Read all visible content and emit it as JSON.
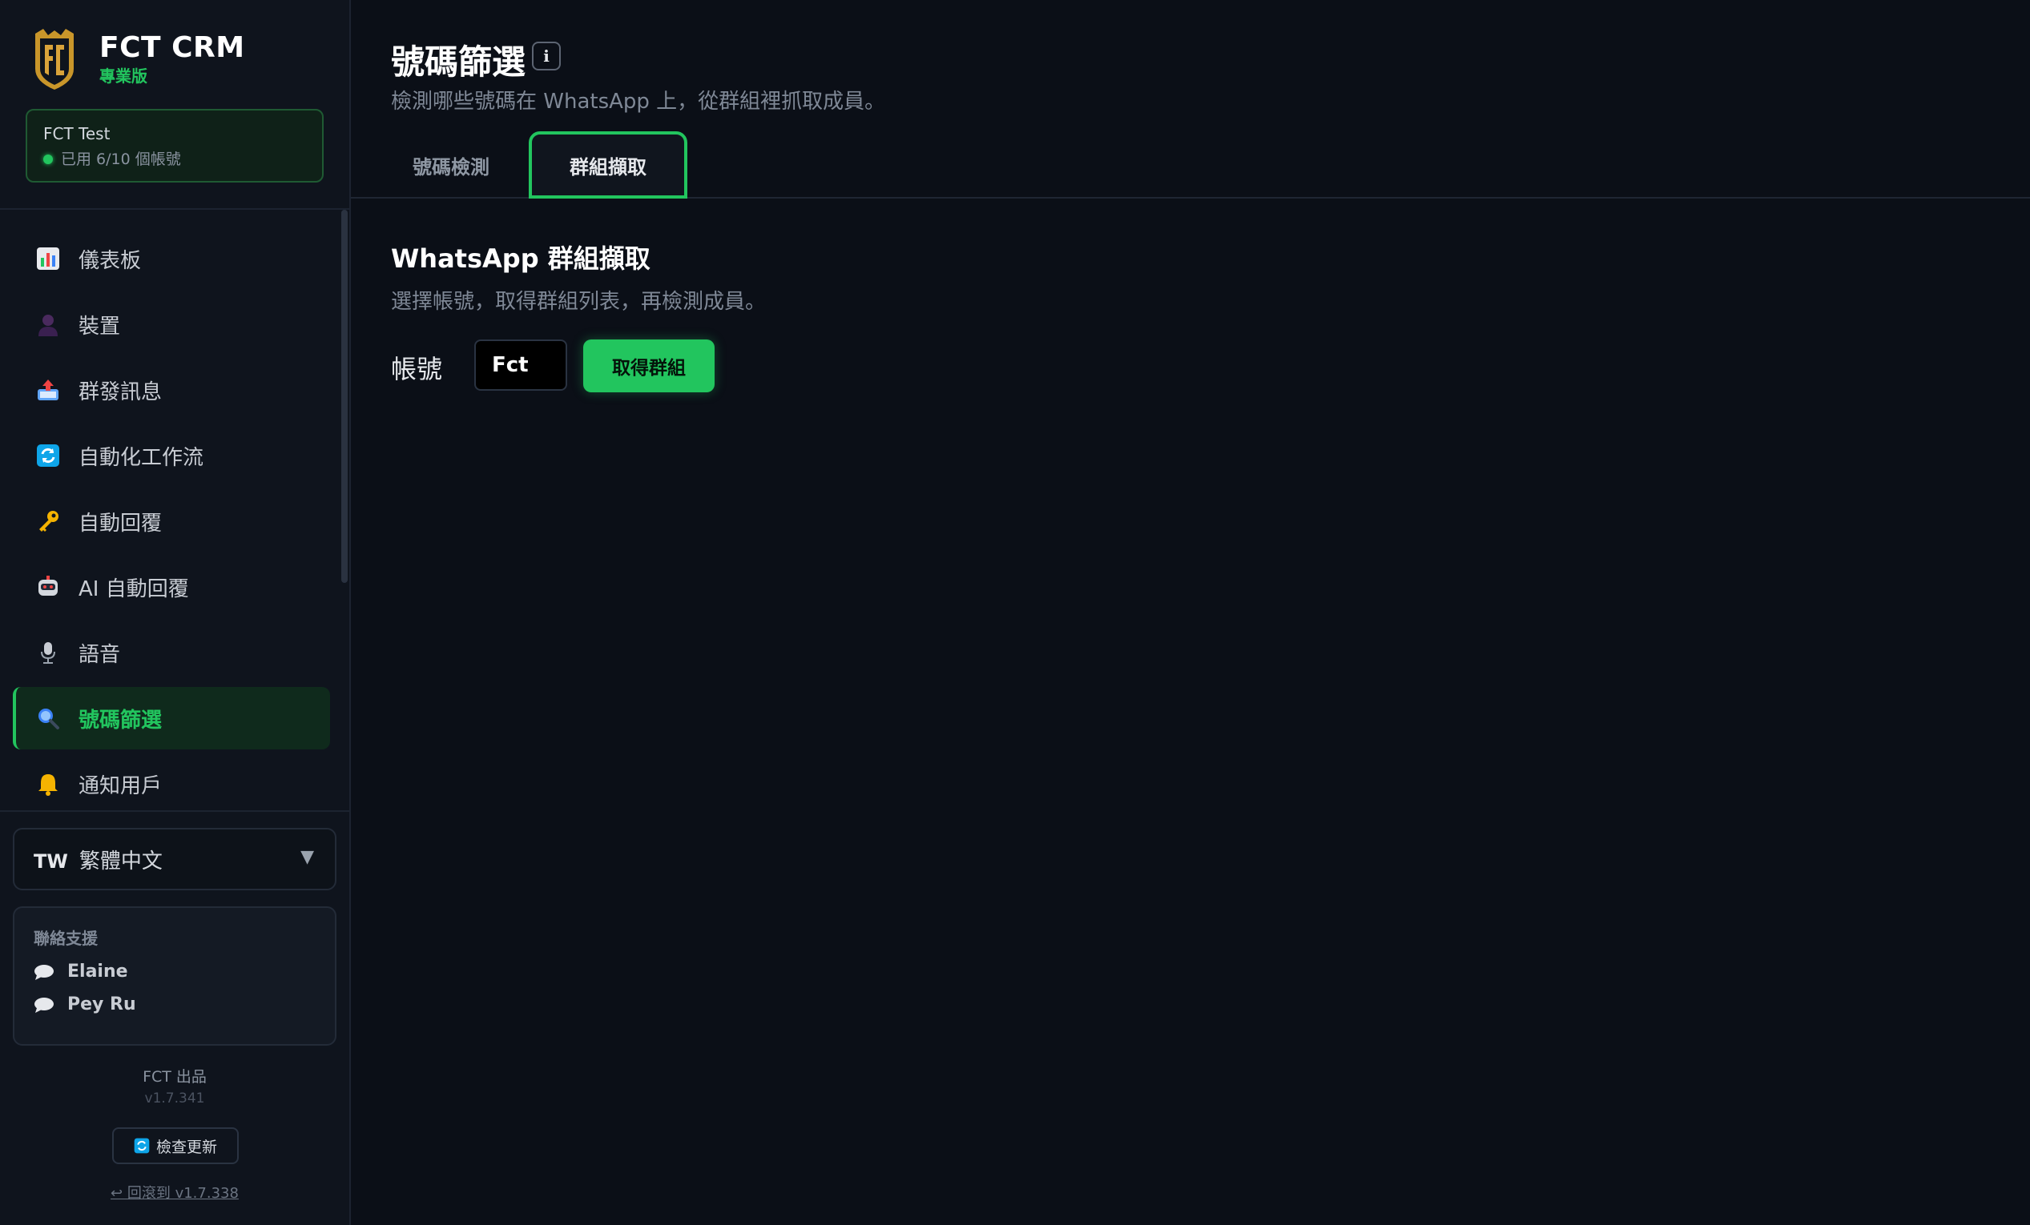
{
  "colors": {
    "accent": "#22c55e",
    "background": "#0b0f17",
    "sidebar": "#0f141d"
  },
  "brand": {
    "name": "FCT CRM",
    "edition": "專業版",
    "logo_icon": "fct-shield-logo"
  },
  "account": {
    "name": "FCT Test",
    "usage": "已用 6/10 個帳號"
  },
  "nav": {
    "items": [
      {
        "label": "儀表板",
        "icon": "bar-chart-icon"
      },
      {
        "label": "裝置",
        "icon": "person-icon"
      },
      {
        "label": "群發訊息",
        "icon": "outbox-tray-icon"
      },
      {
        "label": "自動化工作流",
        "icon": "refresh-arrows-icon"
      },
      {
        "label": "自動回覆",
        "icon": "key-icon"
      },
      {
        "label": "AI 自動回覆",
        "icon": "robot-icon"
      },
      {
        "label": "語音",
        "icon": "microphone-icon"
      },
      {
        "label": "號碼篩選",
        "icon": "magnifier-icon",
        "active": true
      },
      {
        "label": "通知用戶",
        "icon": "bell-icon"
      }
    ]
  },
  "language": {
    "code": "TW",
    "label": "繁體中文"
  },
  "support": {
    "title": "聯絡支援",
    "contacts": [
      "Elaine",
      "Pey Ru"
    ]
  },
  "footer": {
    "by": "FCT 出品",
    "version": "v1.7.341",
    "update_label": "檢查更新",
    "rollback_label": "↩ 回滾到 v1.7.338"
  },
  "page": {
    "title": "號碼篩選",
    "info": "i",
    "subtitle": "檢測哪些號碼在 WhatsApp 上，從群組裡抓取成員。"
  },
  "tabs": [
    {
      "label": "號碼檢測"
    },
    {
      "label": "群組擷取",
      "active": true
    }
  ],
  "section": {
    "title": "WhatsApp 群組擷取",
    "subtitle": "選擇帳號，取得群組列表，再檢測成員。",
    "account_label": "帳號",
    "account_value": "Fct",
    "fetch_label": "取得群組"
  }
}
